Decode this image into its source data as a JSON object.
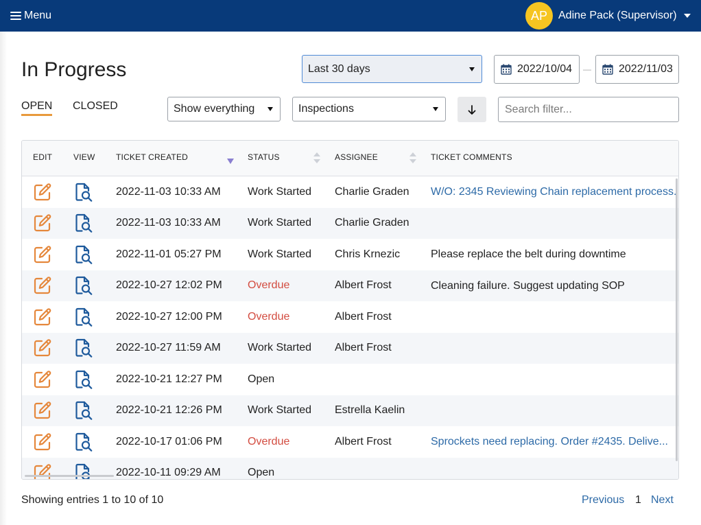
{
  "topbar": {
    "menu_label": "Menu",
    "menu_icon": "hamburger-icon",
    "user": {
      "initials": "AP",
      "name": "Adine Pack (Supervisor)",
      "menu_icon": "caret-down-icon"
    }
  },
  "page": {
    "title": "In Progress"
  },
  "tabs": [
    {
      "label": "OPEN",
      "active": true
    },
    {
      "label": "CLOSED",
      "active": false
    }
  ],
  "filters": {
    "date_range": {
      "selected": "Last 30 days",
      "icon": "caret-down-icon"
    },
    "start_date": "2022/10/04",
    "date_separator": "—",
    "end_date": "2022/11/03",
    "date_icon": "calendar-icon",
    "scope": {
      "selected": "Show everything",
      "icon": "caret-down-icon"
    },
    "type": {
      "selected": "Inspections",
      "icon": "caret-down-icon"
    },
    "sort_button": {
      "icon": "arrow-down-icon"
    },
    "search": {
      "value": "",
      "placeholder": "Search filter..."
    }
  },
  "table": {
    "columns": [
      {
        "label": "EDIT"
      },
      {
        "label": "VIEW"
      },
      {
        "label": "TICKET CREATED",
        "sort_icon": "sort-desc-icon"
      },
      {
        "label": "STATUS",
        "sort_icon": "sort-both-icon"
      },
      {
        "label": "ASSIGNEE",
        "sort_icon": "sort-both-icon"
      },
      {
        "label": "TICKET COMMENTS"
      }
    ],
    "row_icons": {
      "edit": "edit-icon",
      "view": "view-document-icon"
    },
    "rows": [
      {
        "created": "2022-11-03 10:33 AM",
        "status": "Work Started",
        "status_color": "#222222",
        "assignee": "Charlie Graden",
        "comment": "W/O: 2345 Reviewing Chain replacement process.",
        "comment_link": true
      },
      {
        "created": "2022-11-03 10:33 AM",
        "status": "Work Started",
        "status_color": "#222222",
        "assignee": "Charlie Graden",
        "comment": "",
        "comment_link": false
      },
      {
        "created": "2022-11-01 05:27 PM",
        "status": "Work Started",
        "status_color": "#222222",
        "assignee": "Chris Krnezic",
        "comment": "Please replace the belt during downtime",
        "comment_link": false
      },
      {
        "created": "2022-10-27 12:02 PM",
        "status": "Overdue",
        "status_color": "#d34c40",
        "assignee": "Albert Frost",
        "comment": "Cleaning failure. Suggest updating SOP",
        "comment_link": false
      },
      {
        "created": "2022-10-27 12:00 PM",
        "status": "Overdue",
        "status_color": "#d34c40",
        "assignee": "Albert Frost",
        "comment": "",
        "comment_link": false
      },
      {
        "created": "2022-10-27 11:59 AM",
        "status": "Work Started",
        "status_color": "#222222",
        "assignee": "Albert Frost",
        "comment": "",
        "comment_link": false
      },
      {
        "created": "2022-10-21 12:27 PM",
        "status": "Open",
        "status_color": "#222222",
        "assignee": "",
        "comment": "",
        "comment_link": false
      },
      {
        "created": "2022-10-21 12:26 PM",
        "status": "Work Started",
        "status_color": "#222222",
        "assignee": "Estrella Kaelin",
        "comment": "",
        "comment_link": false
      },
      {
        "created": "2022-10-17 01:06 PM",
        "status": "Overdue",
        "status_color": "#d34c40",
        "assignee": "Albert Frost",
        "comment": "Sprockets need replacing. Order #2435. Delive...",
        "comment_link": true
      },
      {
        "created": "2022-10-11 09:29 AM",
        "status": "Open",
        "status_color": "#222222",
        "assignee": "",
        "comment": "",
        "comment_link": false
      }
    ]
  },
  "footer": {
    "summary": "Showing entries 1 to 10 of 10",
    "pagination": {
      "previous_label": "Previous",
      "pages": [
        {
          "label": "1",
          "current": true
        }
      ],
      "next_label": "Next"
    }
  },
  "colors": {
    "topbar_background": "#083a7a",
    "avatar_background": "#f6c521",
    "active_tab_underline": "#e89a3c",
    "focused_select_border": "#4f8ad6",
    "link": "#2d6aa7",
    "status_overdue": "#d34c40",
    "edit_icon": "#e5873b",
    "view_icon": "#1e5a9c",
    "active_sort": "#8a7fd0",
    "alternate_row": "#f4f6f9"
  }
}
